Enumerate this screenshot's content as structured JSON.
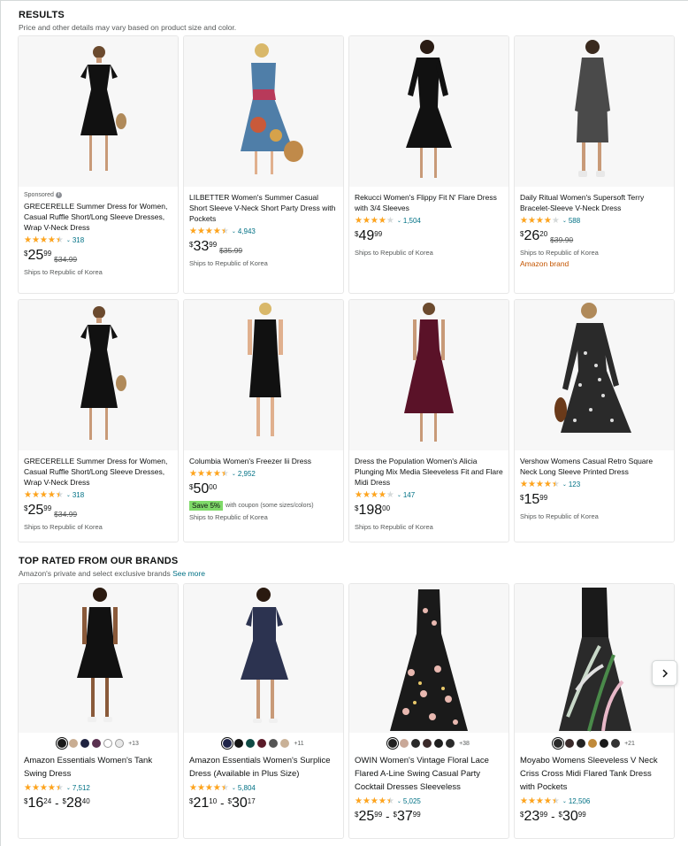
{
  "results_section": {
    "title": "RESULTS",
    "subtitle": "Price and other details may vary based on product size and color."
  },
  "products": [
    {
      "sponsored": "Sponsored",
      "title": "GRECERELLE Summer Dress for Women, Casual Ruffle Short/Long Sleeve Dresses, Wrap V-Neck Dress",
      "rating": 4.5,
      "rating_count": "318",
      "price": {
        "symbol": "$",
        "whole": "25",
        "fraction": "99"
      },
      "list_price": "$34.99",
      "shipping": "Ships to Republic of Korea"
    },
    {
      "title": "LILBETTER Women's Summer Casual Short Sleeve V-Neck Short Party Dress with Pockets",
      "rating": 4.5,
      "rating_count": "4,943",
      "price": {
        "symbol": "$",
        "whole": "33",
        "fraction": "99"
      },
      "list_price": "$35.99",
      "shipping": "Ships to Republic of Korea"
    },
    {
      "title": "Rekucci Women's Flippy Fit N' Flare Dress with 3/4 Sleeves",
      "rating": 4.0,
      "rating_count": "1,504",
      "price": {
        "symbol": "$",
        "whole": "49",
        "fraction": "99"
      },
      "shipping": "Ships to Republic of Korea"
    },
    {
      "title": "Daily Ritual Women's Supersoft Terry Bracelet-Sleeve V-Neck Dress",
      "rating": 4.0,
      "rating_count": "588",
      "price": {
        "symbol": "$",
        "whole": "26",
        "fraction": "20"
      },
      "list_price": "$39.90",
      "shipping": "Ships to Republic of Korea",
      "badge": "Amazon brand"
    },
    {
      "title": "GRECERELLE Summer Dress for Women, Casual Ruffle Short/Long Sleeve Dresses, Wrap V-Neck Dress",
      "rating": 4.5,
      "rating_count": "318",
      "price": {
        "symbol": "$",
        "whole": "25",
        "fraction": "99"
      },
      "list_price": "$34.99",
      "shipping": "Ships to Republic of Korea"
    },
    {
      "title": "Columbia Women's Freezer Iii Dress",
      "rating": 4.5,
      "rating_count": "2,952",
      "price": {
        "symbol": "$",
        "whole": "50",
        "fraction": "00"
      },
      "coupon": {
        "badge": "Save 5%",
        "text": "with coupon (some sizes/colors)"
      },
      "shipping": "Ships to Republic of Korea"
    },
    {
      "title": "Dress the Population Women's Alicia Plunging Mix Media Sleeveless Fit and Flare Midi Dress",
      "rating": 4.0,
      "rating_count": "147",
      "price": {
        "symbol": "$",
        "whole": "198",
        "fraction": "00"
      },
      "shipping": "Ships to Republic of Korea"
    },
    {
      "title": "Vershow Womens Casual Retro Square Neck Long Sleeve Printed Dress",
      "rating": 4.5,
      "rating_count": "123",
      "price": {
        "symbol": "$",
        "whole": "15",
        "fraction": "99"
      },
      "shipping": "Ships to Republic of Korea"
    }
  ],
  "brands_section": {
    "title": "TOP RATED FROM OUR BRANDS",
    "subtitle": "Amazon's private and select exclusive brands",
    "see_more": "See more"
  },
  "brand_products": [
    {
      "title": "Amazon Essentials Women's Tank Swing Dress",
      "rating": 4.5,
      "rating_count": "7,512",
      "swatches": [
        "#1a1a1a",
        "#c9ad92",
        "#1f2340",
        "#5a3150",
        "#ffffff",
        "#e8e8e8"
      ],
      "more_colors": "+13",
      "price_low": {
        "symbol": "$",
        "whole": "16",
        "fraction": "24"
      },
      "price_high": {
        "symbol": "$",
        "whole": "28",
        "fraction": "40"
      }
    },
    {
      "title": "Amazon Essentials Women's Surplice Dress (Available in Plus Size)",
      "rating": 4.5,
      "rating_count": "5,804",
      "swatches": [
        "#20254a",
        "#151515",
        "#0f4a44",
        "#5a1a28",
        "#555555",
        "#c9b197"
      ],
      "more_colors": "+11",
      "price_low": {
        "symbol": "$",
        "whole": "21",
        "fraction": "10"
      },
      "price_high": {
        "symbol": "$",
        "whole": "30",
        "fraction": "17"
      }
    },
    {
      "title": "OWIN Women's Vintage Floral Lace Flared A-Line Swing Casual Party Cocktail Dresses Sleeveless",
      "rating": 4.5,
      "rating_count": "5,025",
      "swatches": [
        "#222222",
        "#c9a898",
        "#2a2a2a",
        "#3a2a2a",
        "#1f1f1f",
        "#2b2b2b"
      ],
      "more_colors": "+38",
      "price_low": {
        "symbol": "$",
        "whole": "25",
        "fraction": "99"
      },
      "price_high": {
        "symbol": "$",
        "whole": "37",
        "fraction": "99"
      }
    },
    {
      "title": "Moyabo Womens Sleeveless V Neck Criss Cross Midi Flared Tank Dress with Pockets",
      "rating": 4.5,
      "rating_count": "12,506",
      "swatches": [
        "#2a2a2a",
        "#3a2a2a",
        "#222222",
        "#c08a3a",
        "#1a1a1a",
        "#333333"
      ],
      "more_colors": "+21",
      "price_low": {
        "symbol": "$",
        "whole": "23",
        "fraction": "99"
      },
      "price_high": {
        "symbol": "$",
        "whole": "30",
        "fraction": "99"
      }
    }
  ],
  "carousel": {
    "next_icon": "chevron-right-icon"
  },
  "colors": {
    "star": "#ffa41c",
    "link": "#007185",
    "brand_badge": "#c45500",
    "coupon": "#7fda69"
  }
}
